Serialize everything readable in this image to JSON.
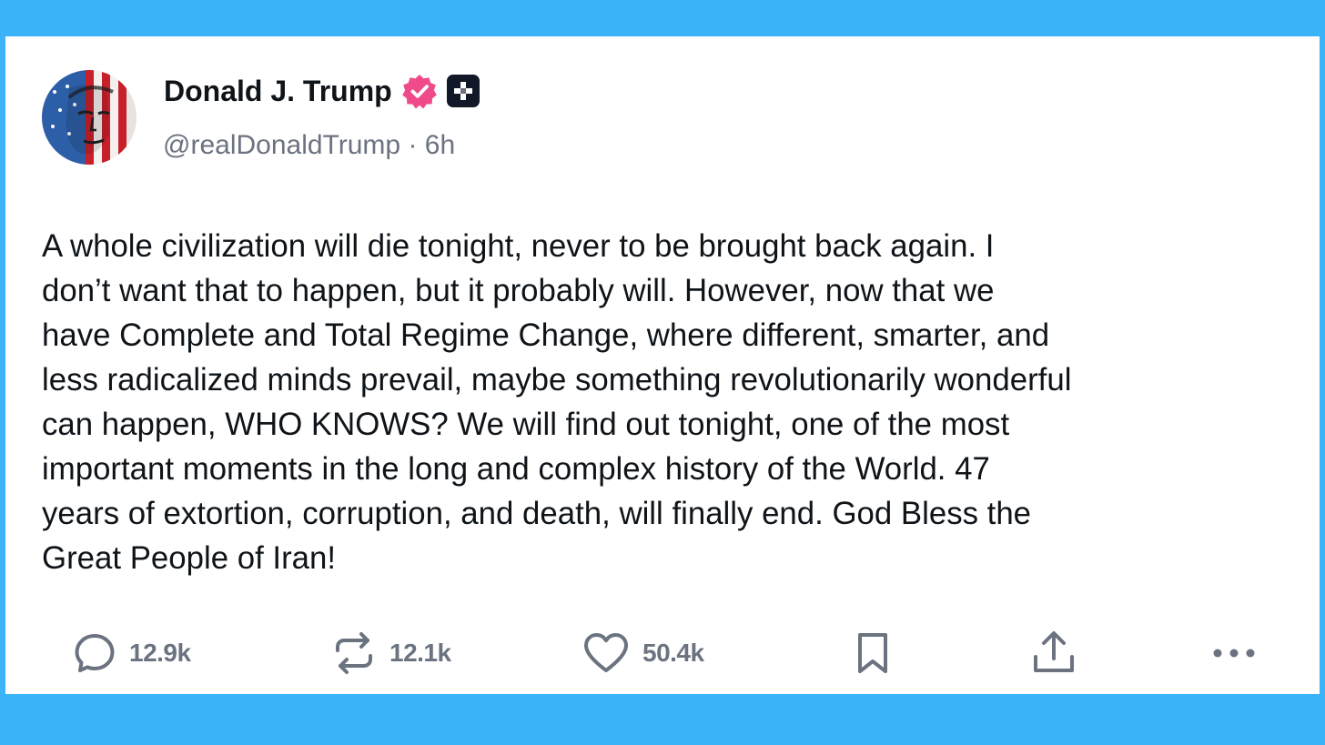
{
  "author": {
    "name": "Donald J. Trump",
    "handle": "@realDonaldTrump",
    "separator": "·",
    "age": "6h",
    "verified_icon": "verified-badge-icon",
    "plus_icon": "truth-plus-icon"
  },
  "post": {
    "text": "A whole civilization will die tonight, never to be brought back again. I\ndon’t want that to happen, but it probably will. However, now that we\nhave Complete and Total Regime Change, where different, smarter, and\nless radicalized minds prevail, maybe something revolutionarily wonderful\ncan happen, WHO KNOWS? We will find out tonight, one of the most\nimportant moments in the long and complex history of the World. 47\nyears of extortion, corruption, and death, will finally end. God Bless the\nGreat People of Iran!"
  },
  "actions": {
    "reply": {
      "icon": "reply-icon",
      "count": "12.9k"
    },
    "retruth": {
      "icon": "retruth-icon",
      "count": "12.1k"
    },
    "like": {
      "icon": "heart-icon",
      "count": "50.4k"
    },
    "bookmark": {
      "icon": "bookmark-icon"
    },
    "share": {
      "icon": "share-icon"
    },
    "more": {
      "icon": "more-icon"
    }
  },
  "colors": {
    "frame": "#3bb3f8",
    "card": "#ffffff",
    "text": "#0f1419",
    "muted": "#6b7280",
    "verified": "#ef4b8a",
    "plus_badge": "#111827"
  }
}
